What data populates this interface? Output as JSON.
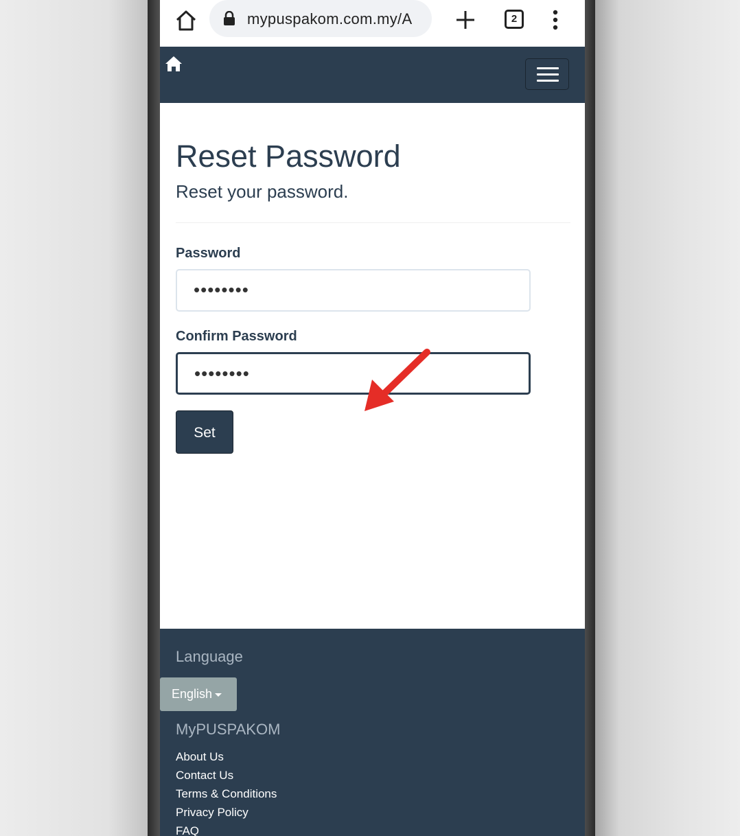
{
  "browser": {
    "url": "mypuspakom.com.my/A",
    "tab_count": "2",
    "icons": [
      "home-icon",
      "lock-icon",
      "plus-icon",
      "tabs-icon",
      "more-vert-icon"
    ]
  },
  "nav": {
    "icons": [
      "home-icon",
      "hamburger-menu-icon"
    ]
  },
  "form": {
    "title": "Reset Password",
    "subtitle": "Reset your password.",
    "password_label": "Password",
    "password_value": "••••••••",
    "confirm_label": "Confirm Password",
    "confirm_value": "••••••••",
    "submit_label": "Set"
  },
  "footer": {
    "language_heading": "Language",
    "language_selected": "English",
    "site_heading": "MyPUSPAKOM",
    "links": [
      "About Us",
      "Contact Us",
      "Terms & Conditions",
      "Privacy Policy",
      "FAQ"
    ]
  },
  "colors": {
    "primary": "#2c3e50",
    "secondary": "#95a5a6",
    "annotation_arrow": "#e52d27"
  }
}
